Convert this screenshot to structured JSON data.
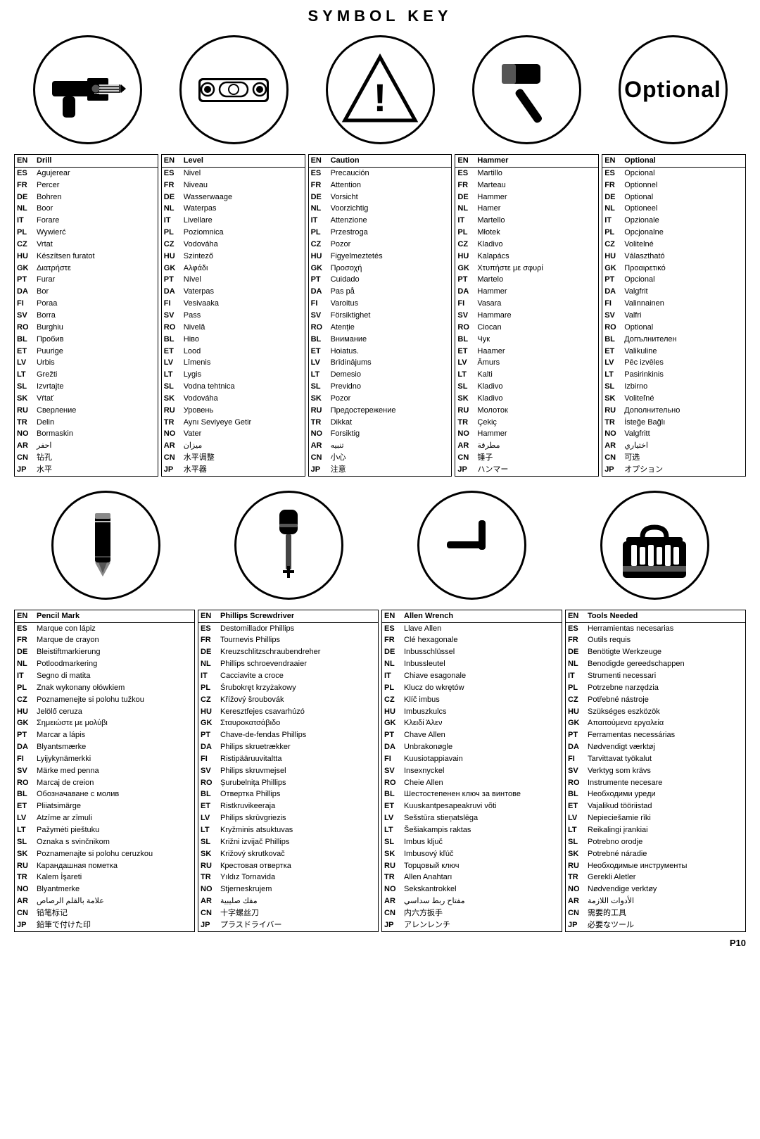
{
  "page": {
    "title": "SYMBOL KEY",
    "page_number": "P10"
  },
  "row1": {
    "icons": [
      "drill",
      "level",
      "caution",
      "hammer",
      "optional"
    ]
  },
  "row2": {
    "icons": [
      "pencil-mark",
      "phillips-screwdriver",
      "allen-wrench",
      "tools-needed"
    ]
  },
  "tables": {
    "drill": {
      "en_label": "EN",
      "en_value": "Drill",
      "rows": [
        [
          "ES",
          "Agujerear"
        ],
        [
          "FR",
          "Percer"
        ],
        [
          "DE",
          "Bohren"
        ],
        [
          "NL",
          "Boor"
        ],
        [
          "IT",
          "Forare"
        ],
        [
          "PL",
          "Wywierć"
        ],
        [
          "CZ",
          "Vrtat"
        ],
        [
          "HU",
          "Készítsen furatot"
        ],
        [
          "GK",
          "Διατρήστε"
        ],
        [
          "PT",
          "Furar"
        ],
        [
          "DA",
          "Bor"
        ],
        [
          "FI",
          "Poraa"
        ],
        [
          "SV",
          "Borra"
        ],
        [
          "RO",
          "Burghiu"
        ],
        [
          "BL",
          "Пробив"
        ],
        [
          "ET",
          "Puurige"
        ],
        [
          "LV",
          "Urbis"
        ],
        [
          "LT",
          "Grežti"
        ],
        [
          "SL",
          "Izvrtajte"
        ],
        [
          "SK",
          "Vŕtať"
        ],
        [
          "RU",
          "Сверление"
        ],
        [
          "TR",
          "Delin"
        ],
        [
          "NO",
          "Bormaskin"
        ],
        [
          "AR",
          "احفر"
        ],
        [
          "CN",
          "钻孔"
        ],
        [
          "JP",
          "水平"
        ]
      ]
    },
    "level": {
      "en_label": "EN",
      "en_value": "Level",
      "rows": [
        [
          "ES",
          "Nivel"
        ],
        [
          "FR",
          "Niveau"
        ],
        [
          "DE",
          "Wasserwaage"
        ],
        [
          "NL",
          "Waterpas"
        ],
        [
          "IT",
          "Livellare"
        ],
        [
          "PL",
          "Poziomnica"
        ],
        [
          "CZ",
          "Vodováha"
        ],
        [
          "HU",
          "Szintező"
        ],
        [
          "GK",
          "Αλφάδι"
        ],
        [
          "PT",
          "Nível"
        ],
        [
          "DA",
          "Vaterpas"
        ],
        [
          "FI",
          "Vesivaaka"
        ],
        [
          "SV",
          "Pass"
        ],
        [
          "RO",
          "Nivelă"
        ],
        [
          "BL",
          "Нiво"
        ],
        [
          "ET",
          "Lood"
        ],
        [
          "LV",
          "Līmenis"
        ],
        [
          "LT",
          "Lygis"
        ],
        [
          "SL",
          "Vodna tehtnica"
        ],
        [
          "SK",
          "Vodováha"
        ],
        [
          "RU",
          "Уровень"
        ],
        [
          "TR",
          "Aynı Seviyeye Getir"
        ],
        [
          "NO",
          "Vater"
        ],
        [
          "AR",
          "ميزان"
        ],
        [
          "CN",
          "水平调整"
        ],
        [
          "JP",
          "水平器"
        ]
      ]
    },
    "caution": {
      "en_label": "EN",
      "en_value": "Caution",
      "rows": [
        [
          "ES",
          "Precaución"
        ],
        [
          "FR",
          "Attention"
        ],
        [
          "DE",
          "Vorsicht"
        ],
        [
          "NL",
          "Voorzichtig"
        ],
        [
          "IT",
          "Attenzione"
        ],
        [
          "PL",
          "Przestroga"
        ],
        [
          "CZ",
          "Pozor"
        ],
        [
          "HU",
          "Figyelmeztetés"
        ],
        [
          "GK",
          "Προσοχή"
        ],
        [
          "PT",
          "Cuidado"
        ],
        [
          "DA",
          "Pas på"
        ],
        [
          "FI",
          "Varoitus"
        ],
        [
          "SV",
          "Försiktighet"
        ],
        [
          "RO",
          "Atenție"
        ],
        [
          "BL",
          "Внимание"
        ],
        [
          "ET",
          "Hoiatus."
        ],
        [
          "LV",
          "Brīdinājums"
        ],
        [
          "LT",
          "Demesio"
        ],
        [
          "SL",
          "Previdno"
        ],
        [
          "SK",
          "Pozor"
        ],
        [
          "RU",
          "Предостережение"
        ],
        [
          "TR",
          "Dikkat"
        ],
        [
          "NO",
          "Forsiktig"
        ],
        [
          "AR",
          "تنبيه"
        ],
        [
          "CN",
          "小心"
        ],
        [
          "JP",
          "注意"
        ]
      ]
    },
    "hammer": {
      "en_label": "EN",
      "en_value": "Hammer",
      "rows": [
        [
          "ES",
          "Martillo"
        ],
        [
          "FR",
          "Marteau"
        ],
        [
          "DE",
          "Hammer"
        ],
        [
          "NL",
          "Hamer"
        ],
        [
          "IT",
          "Martello"
        ],
        [
          "PL",
          "Młotek"
        ],
        [
          "CZ",
          "Kladivo"
        ],
        [
          "HU",
          "Kalapács"
        ],
        [
          "GK",
          "Χτυπήστε με σφυρί"
        ],
        [
          "PT",
          "Martelo"
        ],
        [
          "DA",
          "Hammer"
        ],
        [
          "FI",
          "Vasara"
        ],
        [
          "SV",
          "Hammare"
        ],
        [
          "RO",
          "Ciocan"
        ],
        [
          "BL",
          "Чук"
        ],
        [
          "ET",
          "Haamer"
        ],
        [
          "LV",
          "Āmurs"
        ],
        [
          "LT",
          "Kalti"
        ],
        [
          "SL",
          "Kladivo"
        ],
        [
          "SK",
          "Kladivo"
        ],
        [
          "RU",
          "Молоток"
        ],
        [
          "TR",
          "Çekiç"
        ],
        [
          "NO",
          "Hammer"
        ],
        [
          "AR",
          "مطرقة"
        ],
        [
          "CN",
          "锤子"
        ],
        [
          "JP",
          "ハンマー"
        ]
      ]
    },
    "optional": {
      "en_label": "EN",
      "en_value": "Optional",
      "rows": [
        [
          "ES",
          "Opcional"
        ],
        [
          "FR",
          "Optionnel"
        ],
        [
          "DE",
          "Optional"
        ],
        [
          "NL",
          "Optioneel"
        ],
        [
          "IT",
          "Opzionale"
        ],
        [
          "PL",
          "Opcjonalne"
        ],
        [
          "CZ",
          "Volitelné"
        ],
        [
          "HU",
          "Választható"
        ],
        [
          "GK",
          "Προαιρετικό"
        ],
        [
          "PT",
          "Opcional"
        ],
        [
          "DA",
          "Valgfrit"
        ],
        [
          "FI",
          "Valinnainen"
        ],
        [
          "SV",
          "Valfri"
        ],
        [
          "RO",
          "Optional"
        ],
        [
          "BL",
          "Допълнителен"
        ],
        [
          "ET",
          "Valikuline"
        ],
        [
          "LV",
          "Pēc izvēles"
        ],
        [
          "LT",
          "Pasirinkinis"
        ],
        [
          "SL",
          "Izbirno"
        ],
        [
          "SK",
          "Voliteľné"
        ],
        [
          "RU",
          "Дополнительно"
        ],
        [
          "TR",
          "İsteğe Bağlı"
        ],
        [
          "NO",
          "Valgfritt"
        ],
        [
          "AR",
          "اختياري"
        ],
        [
          "CN",
          "可选"
        ],
        [
          "JP",
          "オプション"
        ]
      ]
    },
    "pencil": {
      "en_label": "EN",
      "en_value": "Pencil Mark",
      "rows": [
        [
          "ES",
          "Marque con lápiz"
        ],
        [
          "FR",
          "Marque de crayon"
        ],
        [
          "DE",
          "Bleistiftmarkierung"
        ],
        [
          "NL",
          "Potloodmarkering"
        ],
        [
          "IT",
          "Segno di matita"
        ],
        [
          "PL",
          "Znak wykonany ołówkiem"
        ],
        [
          "CZ",
          "Poznamenejte si polohu tužkou"
        ],
        [
          "HU",
          "Jelölő ceruza"
        ],
        [
          "GK",
          "Σημειώστε με μολύβι"
        ],
        [
          "PT",
          "Marcar a lápis"
        ],
        [
          "DA",
          "Blyantsmærke"
        ],
        [
          "FI",
          "Lyijykynämerkki"
        ],
        [
          "SV",
          "Märke med penna"
        ],
        [
          "RO",
          "Marcaj de creion"
        ],
        [
          "BL",
          "Обозначаване с молив"
        ],
        [
          "ET",
          "Pliiatsimärge"
        ],
        [
          "LV",
          "Atzīme ar zīmuli"
        ],
        [
          "LT",
          "Pažymėti pieštuku"
        ],
        [
          "SL",
          "Oznaka s svinčnikom"
        ],
        [
          "SK",
          "Poznamenajte si polohu ceruzkou"
        ],
        [
          "RU",
          "Карандашная пометка"
        ],
        [
          "TR",
          "Kalem İşareti"
        ],
        [
          "NO",
          "Blyantmerke"
        ],
        [
          "AR",
          "علامة بالقلم الرصاص"
        ],
        [
          "CN",
          "铅笔标记"
        ],
        [
          "JP",
          "鉛筆で付けた印"
        ]
      ]
    },
    "phillips": {
      "en_label": "EN",
      "en_value": "Phillips Screwdriver",
      "rows": [
        [
          "ES",
          "Destomillador Phillips"
        ],
        [
          "FR",
          "Tournevis Phillips"
        ],
        [
          "DE",
          "Kreuzschlitzschraubendreher"
        ],
        [
          "NL",
          "Phillips schroevendraaier"
        ],
        [
          "IT",
          "Cacciavite a croce"
        ],
        [
          "PL",
          "Śrubokręt krzyżakowy"
        ],
        [
          "CZ",
          "Křížový šroubovák"
        ],
        [
          "HU",
          "Keresztfejes csavarhúzó"
        ],
        [
          "GK",
          "Σταυροκατσάβιδο"
        ],
        [
          "PT",
          "Chave-de-fendas Phillips"
        ],
        [
          "DA",
          "Philips skruetrækker"
        ],
        [
          "FI",
          "Ristipääruuvitaltta"
        ],
        [
          "SV",
          "Philips skruvmejsel"
        ],
        [
          "RO",
          "Șurubelnița Phillips"
        ],
        [
          "BL",
          "Отвертка Phillips"
        ],
        [
          "ET",
          "Ristkruvikeeraja"
        ],
        [
          "LV",
          "Philips skrūvgriezis"
        ],
        [
          "LT",
          "Kryžminis atsuktuvas"
        ],
        [
          "SL",
          "Križni izvijač Phillips"
        ],
        [
          "SK",
          "Križový skrutkovač"
        ],
        [
          "RU",
          "Крестовая отвертка"
        ],
        [
          "TR",
          "Yıldız Tornavida"
        ],
        [
          "NO",
          "Stjerneskrujem"
        ],
        [
          "AR",
          "مفك صليبية"
        ],
        [
          "CN",
          "十字螺丝刀"
        ],
        [
          "JP",
          "プラスドライバー"
        ]
      ]
    },
    "allen": {
      "en_label": "EN",
      "en_value": "Allen Wrench",
      "rows": [
        [
          "ES",
          "Llave Allen"
        ],
        [
          "FR",
          "Clé hexagonale"
        ],
        [
          "DE",
          "Inbusschlüssel"
        ],
        [
          "NL",
          "Inbussleutel"
        ],
        [
          "IT",
          "Chiave esagonale"
        ],
        [
          "PL",
          "Klucz do wkrętów"
        ],
        [
          "CZ",
          "Klíč imbus"
        ],
        [
          "HU",
          "Imbuszkulcs"
        ],
        [
          "GK",
          "Κλειδί Άλεν"
        ],
        [
          "PT",
          "Chave Allen"
        ],
        [
          "DA",
          "Unbrakonøgle"
        ],
        [
          "FI",
          "Kuusiotappiavain"
        ],
        [
          "SV",
          "Insexnyckel"
        ],
        [
          "RO",
          "Cheie Allen"
        ],
        [
          "BL",
          "Шестостепенен ключ за винтове"
        ],
        [
          "ET",
          "Kuuskantpesapeakruvi võti"
        ],
        [
          "LV",
          "Sešstūra stieņatslēga"
        ],
        [
          "LT",
          "Šešiakampis raktas"
        ],
        [
          "SL",
          "Imbus ključ"
        ],
        [
          "SK",
          "Imbusový kľúč"
        ],
        [
          "RU",
          "Торцовый ключ"
        ],
        [
          "TR",
          "Allen Anahtarı"
        ],
        [
          "NO",
          "Sekskantrokkel"
        ],
        [
          "AR",
          "مفتاح ربط سداسي"
        ],
        [
          "CN",
          "内六方扳手"
        ],
        [
          "JP",
          "アレンレンチ"
        ]
      ]
    },
    "tools": {
      "en_label": "EN",
      "en_value": "Tools Needed",
      "rows": [
        [
          "ES",
          "Herramientas necesarias"
        ],
        [
          "FR",
          "Outils requis"
        ],
        [
          "DE",
          "Benötigte Werkzeuge"
        ],
        [
          "NL",
          "Benodigde gereedschappen"
        ],
        [
          "IT",
          "Strumenti necessari"
        ],
        [
          "PL",
          "Potrzebne narzędzia"
        ],
        [
          "CZ",
          "Potřebné nástroje"
        ],
        [
          "HU",
          "Szükséges eszközök"
        ],
        [
          "GK",
          "Απαιτούμενα εργαλεία"
        ],
        [
          "PT",
          "Ferramentas necessárias"
        ],
        [
          "DA",
          "Nødvendigt værktøj"
        ],
        [
          "FI",
          "Tarvittavat työkalut"
        ],
        [
          "SV",
          "Verktyg som krävs"
        ],
        [
          "RO",
          "Instrumente necesare"
        ],
        [
          "BL",
          "Необходими уреди"
        ],
        [
          "ET",
          "Vajalikud tööriistad"
        ],
        [
          "LV",
          "Nepieciešamie rīki"
        ],
        [
          "LT",
          "Reikalingi įrankiai"
        ],
        [
          "SL",
          "Potrebno orodje"
        ],
        [
          "SK",
          "Potrebné náradie"
        ],
        [
          "RU",
          "Необходимые инструменты"
        ],
        [
          "TR",
          "Gerekli Aletler"
        ],
        [
          "NO",
          "Nødvendige verktøy"
        ],
        [
          "AR",
          "الأدوات اللازمة"
        ],
        [
          "CN",
          "需要的工具"
        ],
        [
          "JP",
          "必要なツール"
        ]
      ]
    }
  }
}
